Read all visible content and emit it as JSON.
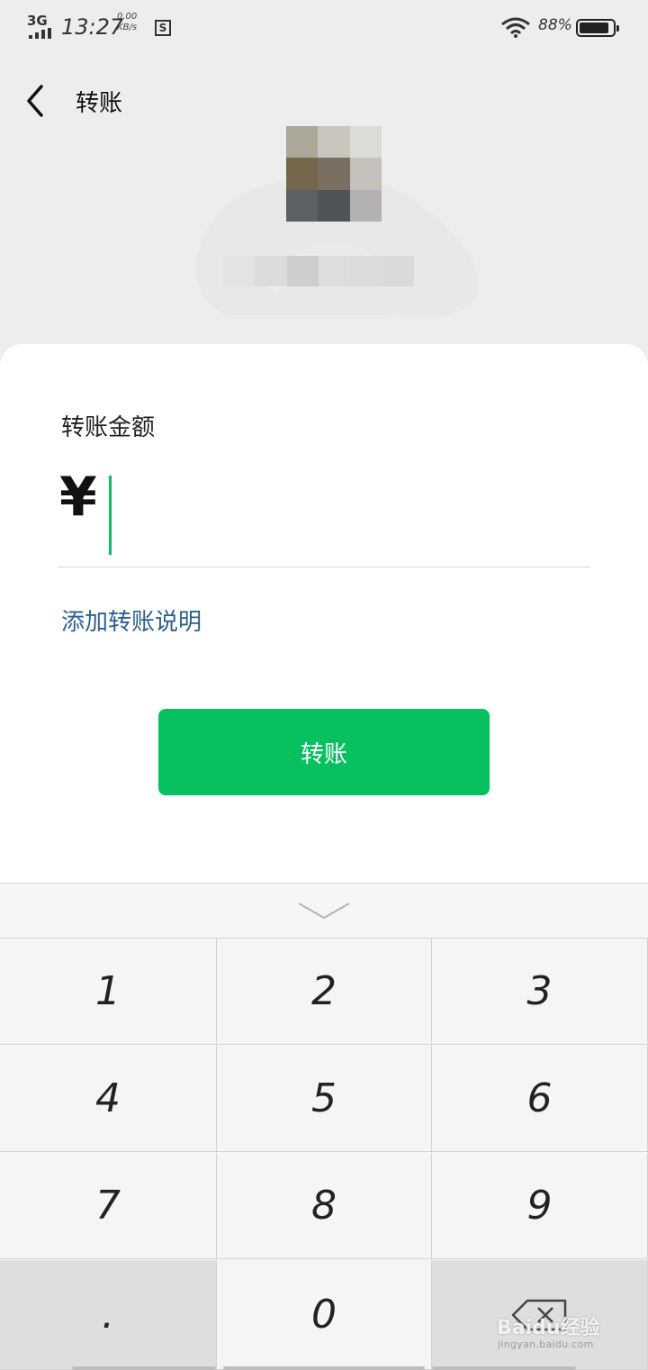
{
  "status_bar": {
    "network": "3G",
    "time": "13:27",
    "speed_value": "0.00",
    "speed_unit": "KB/s",
    "screenshot_badge": "S",
    "battery_percent": "88%",
    "battery_level": 0.88
  },
  "nav": {
    "back_icon": "chevron-left-icon",
    "title": "转账"
  },
  "form": {
    "amount_label": "转账金额",
    "currency_symbol": "¥",
    "amount_value": "",
    "add_remark_link": "添加转账说明",
    "submit_button": "转账"
  },
  "keypad": {
    "collapse_icon": "chevron-down-icon",
    "keys": [
      "1",
      "2",
      "3",
      "4",
      "5",
      "6",
      "7",
      "8",
      "9",
      ".",
      "0"
    ],
    "delete_icon": "backspace-icon"
  },
  "watermark": {
    "brand": "Baidu经验",
    "url": "jingyan.baidu.com"
  },
  "colors": {
    "accent_green": "#07c160",
    "link_blue": "#2b5f93",
    "page_bg": "#ededed"
  }
}
